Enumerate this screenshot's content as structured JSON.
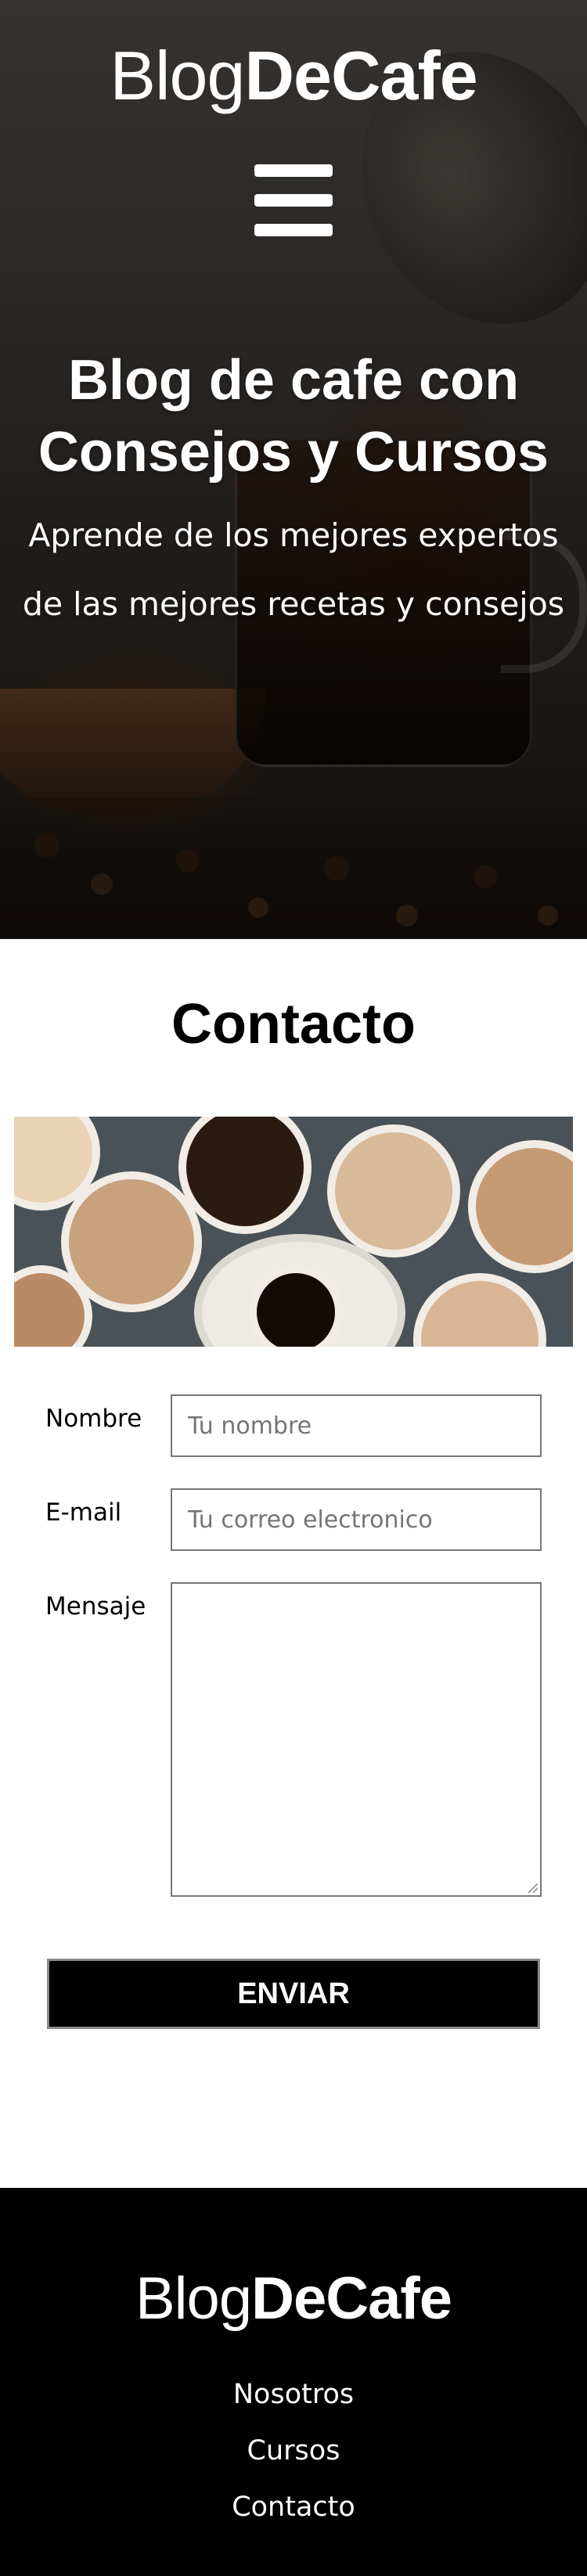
{
  "brand": {
    "light": "Blog",
    "bold": "DeCafe"
  },
  "hero": {
    "title": "Blog de cafe con Consejos y Cursos",
    "subtitle": "Aprende de los mejores expertos de las mejores recetas y consejos"
  },
  "contact": {
    "title": "Contacto",
    "form": {
      "name_label": "Nombre",
      "name_placeholder": "Tu nombre",
      "email_label": "E-mail",
      "email_placeholder": "Tu correo electronico",
      "message_label": "Mensaje",
      "submit_label": "ENVIAR"
    }
  },
  "footer": {
    "nav": [
      "Nosotros",
      "Cursos",
      "Contacto"
    ]
  },
  "colors": {
    "footer_bg": "#000000",
    "button_bg": "#000000",
    "text_light": "#ffffff"
  }
}
